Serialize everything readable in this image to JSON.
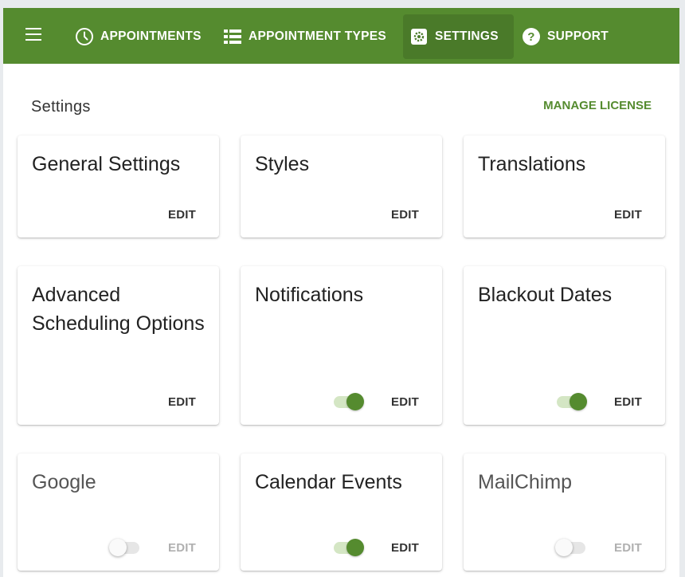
{
  "nav": {
    "menu_icon": "hamburger-menu-icon",
    "items": [
      {
        "label": "APPOINTMENTS",
        "icon": "clock-icon",
        "active": false
      },
      {
        "label": "APPOINTMENT TYPES",
        "icon": "list-icon",
        "active": false
      },
      {
        "label": "SETTINGS",
        "icon": "gear-icon",
        "active": true
      },
      {
        "label": "SUPPORT",
        "icon": "help-circle-icon",
        "active": false
      }
    ],
    "accent_color": "#558b2f"
  },
  "page": {
    "title": "Settings",
    "manage_license_label": "MANAGE LICENSE"
  },
  "cards": [
    {
      "title": "General Settings",
      "edit_label": "EDIT",
      "has_toggle": false,
      "enabled": true
    },
    {
      "title": "Styles",
      "edit_label": "EDIT",
      "has_toggle": false,
      "enabled": true
    },
    {
      "title": "Translations",
      "edit_label": "EDIT",
      "has_toggle": false,
      "enabled": true
    },
    {
      "title": "Advanced Scheduling Options",
      "edit_label": "EDIT",
      "has_toggle": false,
      "enabled": true
    },
    {
      "title": "Notifications",
      "edit_label": "EDIT",
      "has_toggle": true,
      "enabled": true
    },
    {
      "title": "Blackout Dates",
      "edit_label": "EDIT",
      "has_toggle": true,
      "enabled": true
    },
    {
      "title": "Google",
      "edit_label": "EDIT",
      "has_toggle": true,
      "enabled": false
    },
    {
      "title": "Calendar Events",
      "edit_label": "EDIT",
      "has_toggle": true,
      "enabled": true
    },
    {
      "title": "MailChimp",
      "edit_label": "EDIT",
      "has_toggle": true,
      "enabled": false
    }
  ]
}
